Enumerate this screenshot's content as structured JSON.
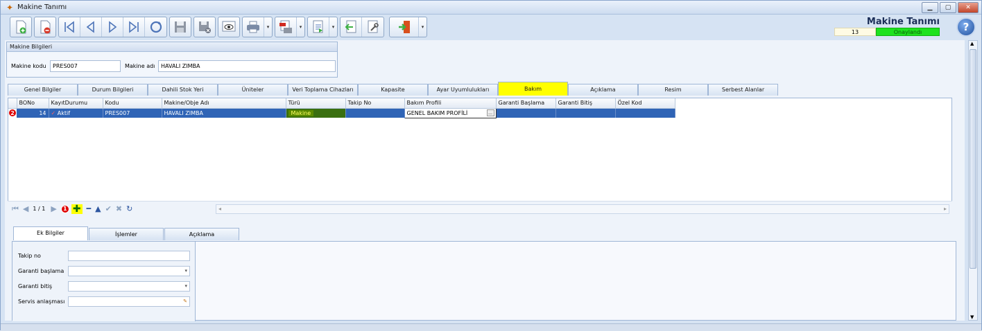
{
  "window": {
    "title": "Makine Tanımı"
  },
  "header": {
    "page_title": "Makine Tanımı",
    "record_no": "13",
    "status": "Onaylandı"
  },
  "colors": {
    "accent_yellow": "#ffff00",
    "status_green": "#1ee21e",
    "selection_blue": "#2f64b6"
  },
  "toolbar_icons": [
    "new-doc-icon",
    "delete-doc-icon",
    "first-record-icon",
    "prev-record-icon",
    "next-record-icon",
    "last-record-icon",
    "refresh-icon",
    "save-icon",
    "save-cancel-icon",
    "preview-icon",
    "print-icon",
    "pdf-export-icon",
    "export-icon",
    "import-icon",
    "tools-icon",
    "exit-icon"
  ],
  "machine_info": {
    "group_title": "Makine Bilgileri",
    "code_label": "Makine kodu",
    "code_value": "PRES007",
    "name_label": "Makine adı",
    "name_value": "HAVALI ZIMBA"
  },
  "tabs": [
    "Genel Bilgiler",
    "Durum Bilgileri",
    "Dahili Stok Yeri",
    "Üniteler",
    "Veri Toplama Cihazları",
    "Kapasite",
    "Ayar Uyumlulukları",
    "Bakım",
    "Açıklama",
    "Resim",
    "Serbest Alanlar"
  ],
  "active_tab": "Bakım",
  "grid": {
    "columns": [
      "BONo",
      "KayıtDurumu",
      "Kodu",
      "Makine/Obje Adı",
      "Türü",
      "Takip No",
      "Bakım Profili",
      "Garanti Başlama",
      "Garanti Bitiş",
      "Özel Kod"
    ],
    "rows": [
      {
        "badge": "2",
        "bono": "14",
        "status": "Aktif",
        "code": "PRES007",
        "name": "HAVALI ZIMBA",
        "type": "Makine",
        "tracking": "",
        "profile": "GENEL BAKIM PROFİLİ",
        "warranty_start": "",
        "warranty_end": "",
        "special_code": ""
      }
    ]
  },
  "navigator": {
    "page": "1 / 1",
    "add_badge": "1"
  },
  "bottom_tabs": [
    "Ek Bilgiler",
    "İşlemler",
    "Açıklama"
  ],
  "form": {
    "tracking_label": "Takip no",
    "warranty_start_label": "Garanti başlama",
    "warranty_end_label": "Garanti bitiş",
    "service_label": "Servis anlaşması"
  }
}
